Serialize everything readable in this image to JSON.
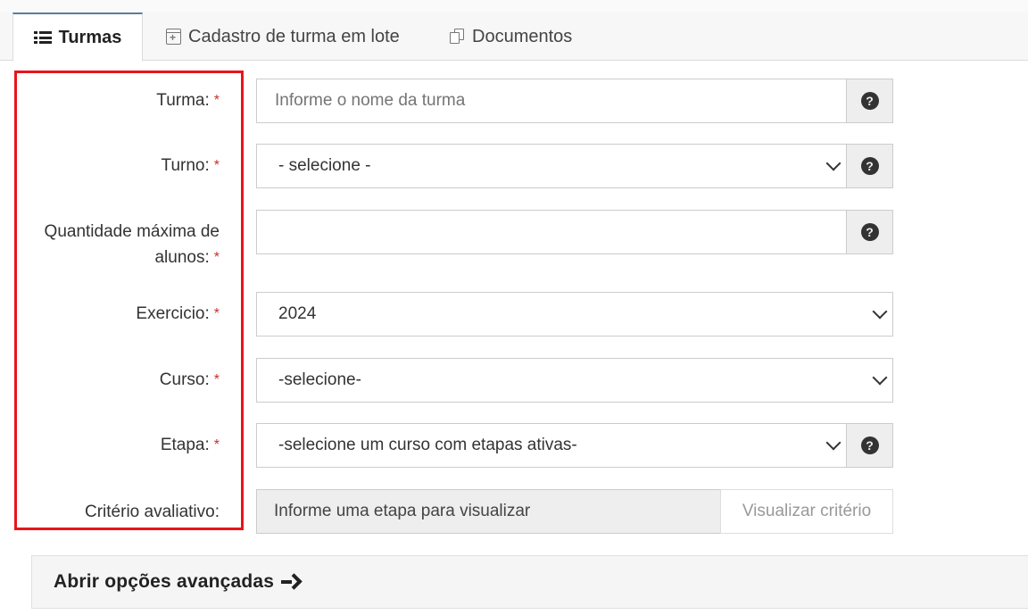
{
  "tabs": [
    {
      "label": "Turmas",
      "icon": "list-icon",
      "active": true
    },
    {
      "label": "Cadastro de turma em lote",
      "icon": "calendar-plus-icon",
      "active": false
    },
    {
      "label": "Documentos",
      "icon": "documents-icon",
      "active": false
    }
  ],
  "form": {
    "required_mark": "*",
    "turma": {
      "label": "Turma:",
      "value": "",
      "placeholder": "Informe o nome da turma"
    },
    "turno": {
      "label": "Turno:",
      "selected": "- selecione -"
    },
    "quantidade": {
      "label_line1": "Quantidade máxima de",
      "label_line2": "alunos:",
      "value": ""
    },
    "exercicio": {
      "label": "Exercicio:",
      "selected": "2024"
    },
    "curso": {
      "label": "Curso:",
      "selected": "-selecione-"
    },
    "etapa": {
      "label": "Etapa:",
      "selected": "-selecione um curso com etapas ativas-"
    },
    "criterio": {
      "label": "Critério avaliativo:",
      "value": "Informe uma etapa para visualizar",
      "button": "Visualizar critério"
    },
    "help_glyph": "?"
  },
  "advanced": {
    "label": "Abrir opções avançadas"
  },
  "colors": {
    "highlight_border": "#e8141c",
    "required": "#c9302c",
    "tab_active_top": "#5a7d9a"
  }
}
